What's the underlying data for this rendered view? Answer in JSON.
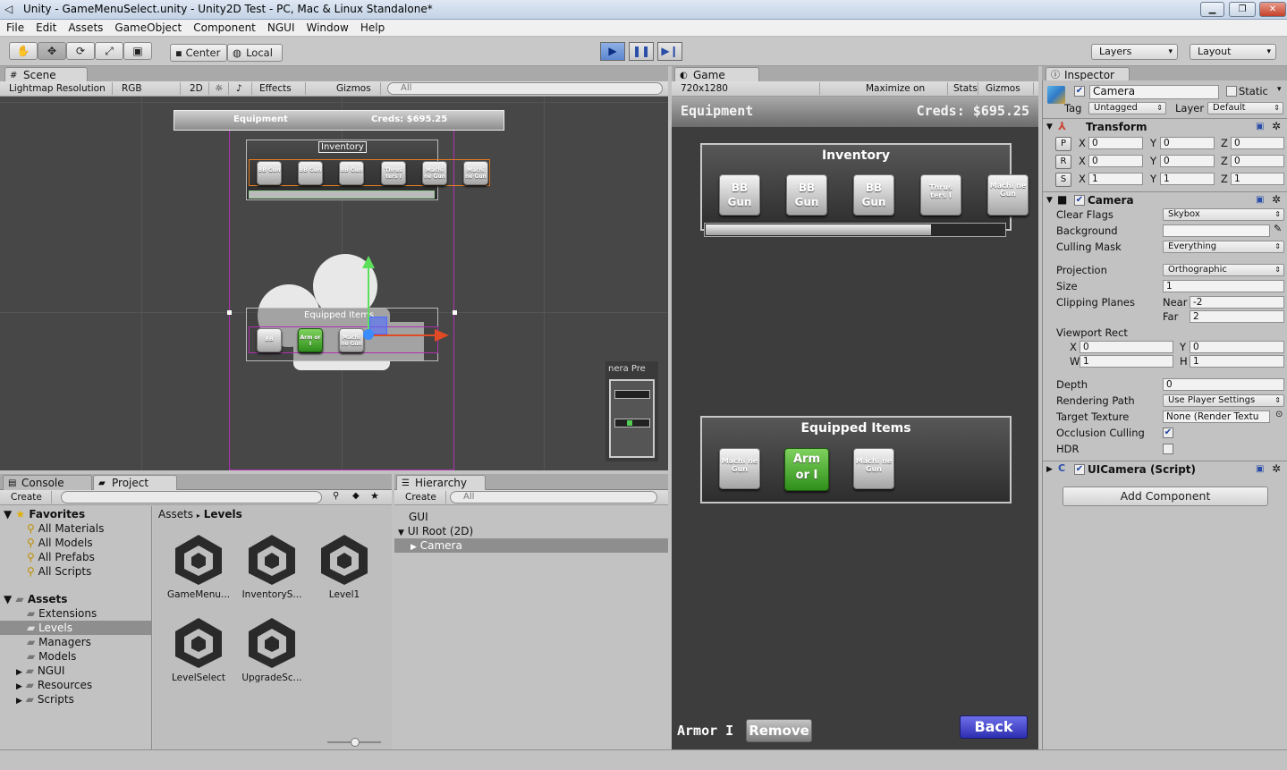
{
  "window": {
    "title": "Unity - GameMenuSelect.unity - Unity2D Test - PC, Mac & Linux Standalone*"
  },
  "menu": [
    "File",
    "Edit",
    "Assets",
    "GameObject",
    "Component",
    "NGUI",
    "Window",
    "Help"
  ],
  "toolbar": {
    "pivot": "Center",
    "space": "Local",
    "layers": "Layers",
    "layout": "Layout"
  },
  "scene": {
    "tab": "Scene",
    "render_mode": "Lightmap Resolution",
    "channel": "RGB",
    "mode2d": "2D",
    "effects": "Effects",
    "gizmos": "Gizmos",
    "search_placeholder": "All",
    "header_left": "Equipment",
    "header_right": "Creds: $695.25",
    "inventory": "Inventory",
    "equipped": "Equipped Items",
    "inv_items": [
      "BB Gun",
      "BB Gun",
      "BB Gun",
      "Thrus ters I",
      "Machi ne Gun",
      "Machi ne Gun"
    ],
    "eq_items": [
      "BB",
      "Arm or I",
      "Machi ne Gun"
    ],
    "preview": "nera Pre"
  },
  "game": {
    "tab": "Game",
    "resolution": "720x1280",
    "maximize": "Maximize on Play",
    "stats": "Stats",
    "gizmos": "Gizmos",
    "title": "Equipment",
    "creds": "Creds: $695.25",
    "inventory_title": "Inventory",
    "inventory_items": [
      "BB Gun",
      "BB Gun",
      "BB Gun",
      "Thrus ters I",
      "Machi ne Gun"
    ],
    "inventory_scroll": 0.75,
    "equipped_title": "Equipped Items",
    "equipped_items": [
      "Machi ne Gun",
      "Arm or I",
      "Machi ne Gun"
    ],
    "selected_label": "Armor I",
    "remove": "Remove",
    "back": "Back"
  },
  "inspector": {
    "tab": "Inspector",
    "object_name": "Camera",
    "static": "Static",
    "tag_label": "Tag",
    "tag": "Untagged",
    "layer_label": "Layer",
    "layer": "Default",
    "transform": {
      "title": "Transform",
      "rows": [
        {
          "btn": "P",
          "x": "0",
          "y": "0",
          "z": "0"
        },
        {
          "btn": "R",
          "x": "0",
          "y": "0",
          "z": "0"
        },
        {
          "btn": "S",
          "x": "1",
          "y": "1",
          "z": "1"
        }
      ]
    },
    "camera": {
      "title": "Camera",
      "clear_flags_label": "Clear Flags",
      "clear_flags": "Skybox",
      "background_label": "Background",
      "culling_mask_label": "Culling Mask",
      "culling_mask": "Everything",
      "projection_label": "Projection",
      "projection": "Orthographic",
      "size_label": "Size",
      "size": "1",
      "clipping_label": "Clipping Planes",
      "near_label": "Near",
      "near": "-2",
      "far_label": "Far",
      "far": "2",
      "viewport_label": "Viewport Rect",
      "vx": "0",
      "vy": "0",
      "vw": "1",
      "vh": "1",
      "depth_label": "Depth",
      "depth": "0",
      "rendering_path_label": "Rendering Path",
      "rendering_path": "Use Player Settings",
      "target_texture_label": "Target Texture",
      "target_texture": "None (Render Textu",
      "occlusion_label": "Occlusion Culling",
      "hdr_label": "HDR"
    },
    "uicamera": "UICamera (Script)",
    "add_component": "Add Component"
  },
  "console_tab": "Console",
  "project": {
    "tab": "Project",
    "create": "Create",
    "favorites": "Favorites",
    "fav_items": [
      "All Materials",
      "All Models",
      "All Prefabs",
      "All Scripts"
    ],
    "assets": "Assets",
    "folders": [
      "Extensions",
      "Levels",
      "Managers",
      "Models",
      "NGUI",
      "Resources",
      "Scripts"
    ],
    "breadcrumb_root": "Assets",
    "breadcrumb_leaf": "Levels",
    "files": [
      "GameMenu...",
      "InventoryS...",
      "Level1",
      "LevelSelect",
      "UpgradeSc..."
    ]
  },
  "hierarchy": {
    "tab": "Hierarchy",
    "create": "Create",
    "search_placeholder": "All",
    "items": [
      "GUI",
      "UI Root (2D)",
      "Camera"
    ]
  }
}
